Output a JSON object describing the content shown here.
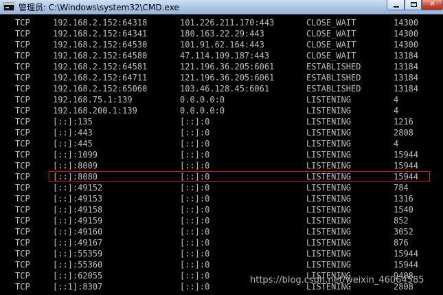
{
  "window": {
    "title": "管理员: C:\\Windows\\system32\\CMD.exe",
    "icon": "cmd-icon",
    "minimize_icon": "minimize-icon",
    "maximize_icon": "maximize-icon",
    "close_label": "✕"
  },
  "colors": {
    "console_bg": "#000000",
    "console_text": "#c0c0c0",
    "highlight_border": "#d11f1f",
    "titlebar": "#b9d1ea"
  },
  "connections": [
    {
      "proto": "TCP",
      "local": "192.168.2.152:64318",
      "foreign": "101.226.211.170:443",
      "state": "CLOSE_WAIT",
      "pid": "14300"
    },
    {
      "proto": "TCP",
      "local": "192.168.2.152:64341",
      "foreign": "180.163.22.29:443",
      "state": "CLOSE_WAIT",
      "pid": "14300"
    },
    {
      "proto": "TCP",
      "local": "192.168.2.152:64530",
      "foreign": "101.91.62.164:443",
      "state": "CLOSE_WAIT",
      "pid": "14300"
    },
    {
      "proto": "TCP",
      "local": "192.168.2.152:64580",
      "foreign": "47.114.109.187:443",
      "state": "CLOSE_WAIT",
      "pid": "13184"
    },
    {
      "proto": "TCP",
      "local": "192.168.2.152:64581",
      "foreign": "121.196.36.205:6061",
      "state": "ESTABLISHED",
      "pid": "13184"
    },
    {
      "proto": "TCP",
      "local": "192.168.2.152:64711",
      "foreign": "121.196.36.205:6061",
      "state": "ESTABLISHED",
      "pid": "13184"
    },
    {
      "proto": "TCP",
      "local": "192.168.2.152:65060",
      "foreign": "103.46.128.45:6061",
      "state": "ESTABLISHED",
      "pid": "13184"
    },
    {
      "proto": "TCP",
      "local": "192.168.75.1:139",
      "foreign": "0.0.0.0:0",
      "state": "LISTENING",
      "pid": "4"
    },
    {
      "proto": "TCP",
      "local": "192.168.200.1:139",
      "foreign": "0.0.0.0:0",
      "state": "LISTENING",
      "pid": "4"
    },
    {
      "proto": "TCP",
      "local": "[::]:135",
      "foreign": "[::]:0",
      "state": "LISTENING",
      "pid": "1216"
    },
    {
      "proto": "TCP",
      "local": "[::]:443",
      "foreign": "[::]:0",
      "state": "LISTENING",
      "pid": "2808"
    },
    {
      "proto": "TCP",
      "local": "[::]:445",
      "foreign": "[::]:0",
      "state": "LISTENING",
      "pid": "4"
    },
    {
      "proto": "TCP",
      "local": "[::]:1099",
      "foreign": "[::]:0",
      "state": "LISTENING",
      "pid": "15944"
    },
    {
      "proto": "TCP",
      "local": "[::]:8009",
      "foreign": "[::]:0",
      "state": "LISTENING",
      "pid": "15944"
    },
    {
      "proto": "TCP",
      "local": "[::]:8080",
      "foreign": "[::]:0",
      "state": "LISTENING",
      "pid": "15944"
    },
    {
      "proto": "TCP",
      "local": "[::]:49152",
      "foreign": "[::]:0",
      "state": "LISTENING",
      "pid": "784"
    },
    {
      "proto": "TCP",
      "local": "[::]:49153",
      "foreign": "[::]:0",
      "state": "LISTENING",
      "pid": "1316"
    },
    {
      "proto": "TCP",
      "local": "[::]:49158",
      "foreign": "[::]:0",
      "state": "LISTENING",
      "pid": "1540"
    },
    {
      "proto": "TCP",
      "local": "[::]:49159",
      "foreign": "[::]:0",
      "state": "LISTENING",
      "pid": "852"
    },
    {
      "proto": "TCP",
      "local": "[::]:49160",
      "foreign": "[::]:0",
      "state": "LISTENING",
      "pid": "3052"
    },
    {
      "proto": "TCP",
      "local": "[::]:49167",
      "foreign": "[::]:0",
      "state": "LISTENING",
      "pid": "876"
    },
    {
      "proto": "TCP",
      "local": "[::]:55359",
      "foreign": "[::]:0",
      "state": "LISTENING",
      "pid": "15944"
    },
    {
      "proto": "TCP",
      "local": "[::]:55360",
      "foreign": "[::]:0",
      "state": "LISTENING",
      "pid": "15944"
    },
    {
      "proto": "TCP",
      "local": "[::]:62055",
      "foreign": "[::]:0",
      "state": "LISTENING",
      "pid": "9408"
    },
    {
      "proto": "TCP",
      "local": "[::1]:8307",
      "foreign": "[::]:0",
      "state": "LISTENING",
      "pid": "2808"
    }
  ],
  "highlighted_row": 14,
  "watermark": "https://blog.csdn.net/weixin_46064585"
}
